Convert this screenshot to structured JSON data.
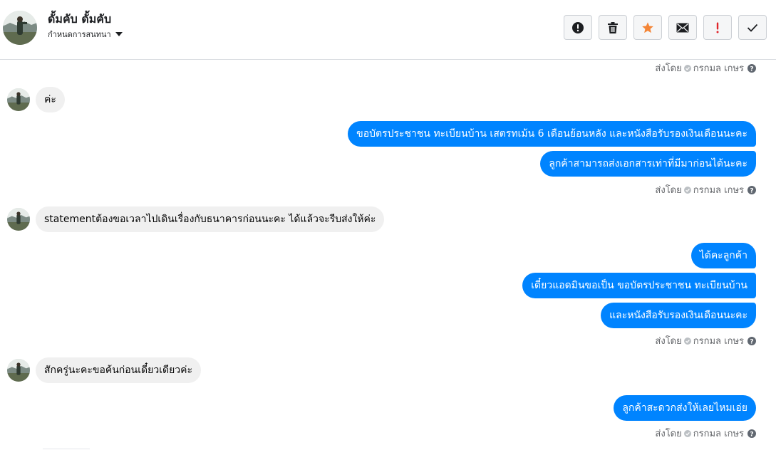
{
  "header": {
    "name": "ดั้มคับ ดั้มคับ",
    "subtitle": "กำหนดการสนทนา",
    "toolbar": [
      {
        "id": "spam",
        "icon": "alert-circle-icon"
      },
      {
        "id": "delete",
        "icon": "trash-icon"
      },
      {
        "id": "star",
        "icon": "star-icon",
        "color": "#f48536"
      },
      {
        "id": "unread",
        "icon": "envelope-icon"
      },
      {
        "id": "important",
        "icon": "exclamation-icon",
        "color": "#e0262b"
      },
      {
        "id": "done",
        "icon": "check-icon"
      }
    ]
  },
  "colors": {
    "outgoing_bubble": "#0084ff",
    "incoming_bubble": "#f0f0f0",
    "meta_text": "#65676b"
  },
  "sent_by": {
    "label": "ส่งโดย",
    "agent": "กรกมล เกษร"
  },
  "messages": {
    "m1": "ค่ะ",
    "m2": "ขอบัตรประชาชน ทะเบียนบ้าน เสตรทเม้น 6 เดือนย้อนหลัง และหนังสือรับรองเงินเดือนนะคะ",
    "m3": "ลูกค้าสามารถส่งเอกสารเท่าที่มีมาก่อนได้นะคะ",
    "m4": "statementต้องขอเวลาไปเดินเรื่องกับธนาคารก่อนนะคะ ได้แล้วจะรีบส่งให้ค่ะ",
    "m5": "ได้คะลูกค้า",
    "m6": "เดี๋ยวแอดมินขอเป็น  ขอบัตรประชาชน ทะเบียนบ้าน",
    "m7": "และหนังสือรับรองเงินเดือนนะคะ",
    "m8": "สักครู่นะคะขอค้นก่อนเดี๋ยวเดียวค่ะ",
    "m9": "ลูกค้าสะดวกส่งให้เลยไหมเอ่ย"
  }
}
